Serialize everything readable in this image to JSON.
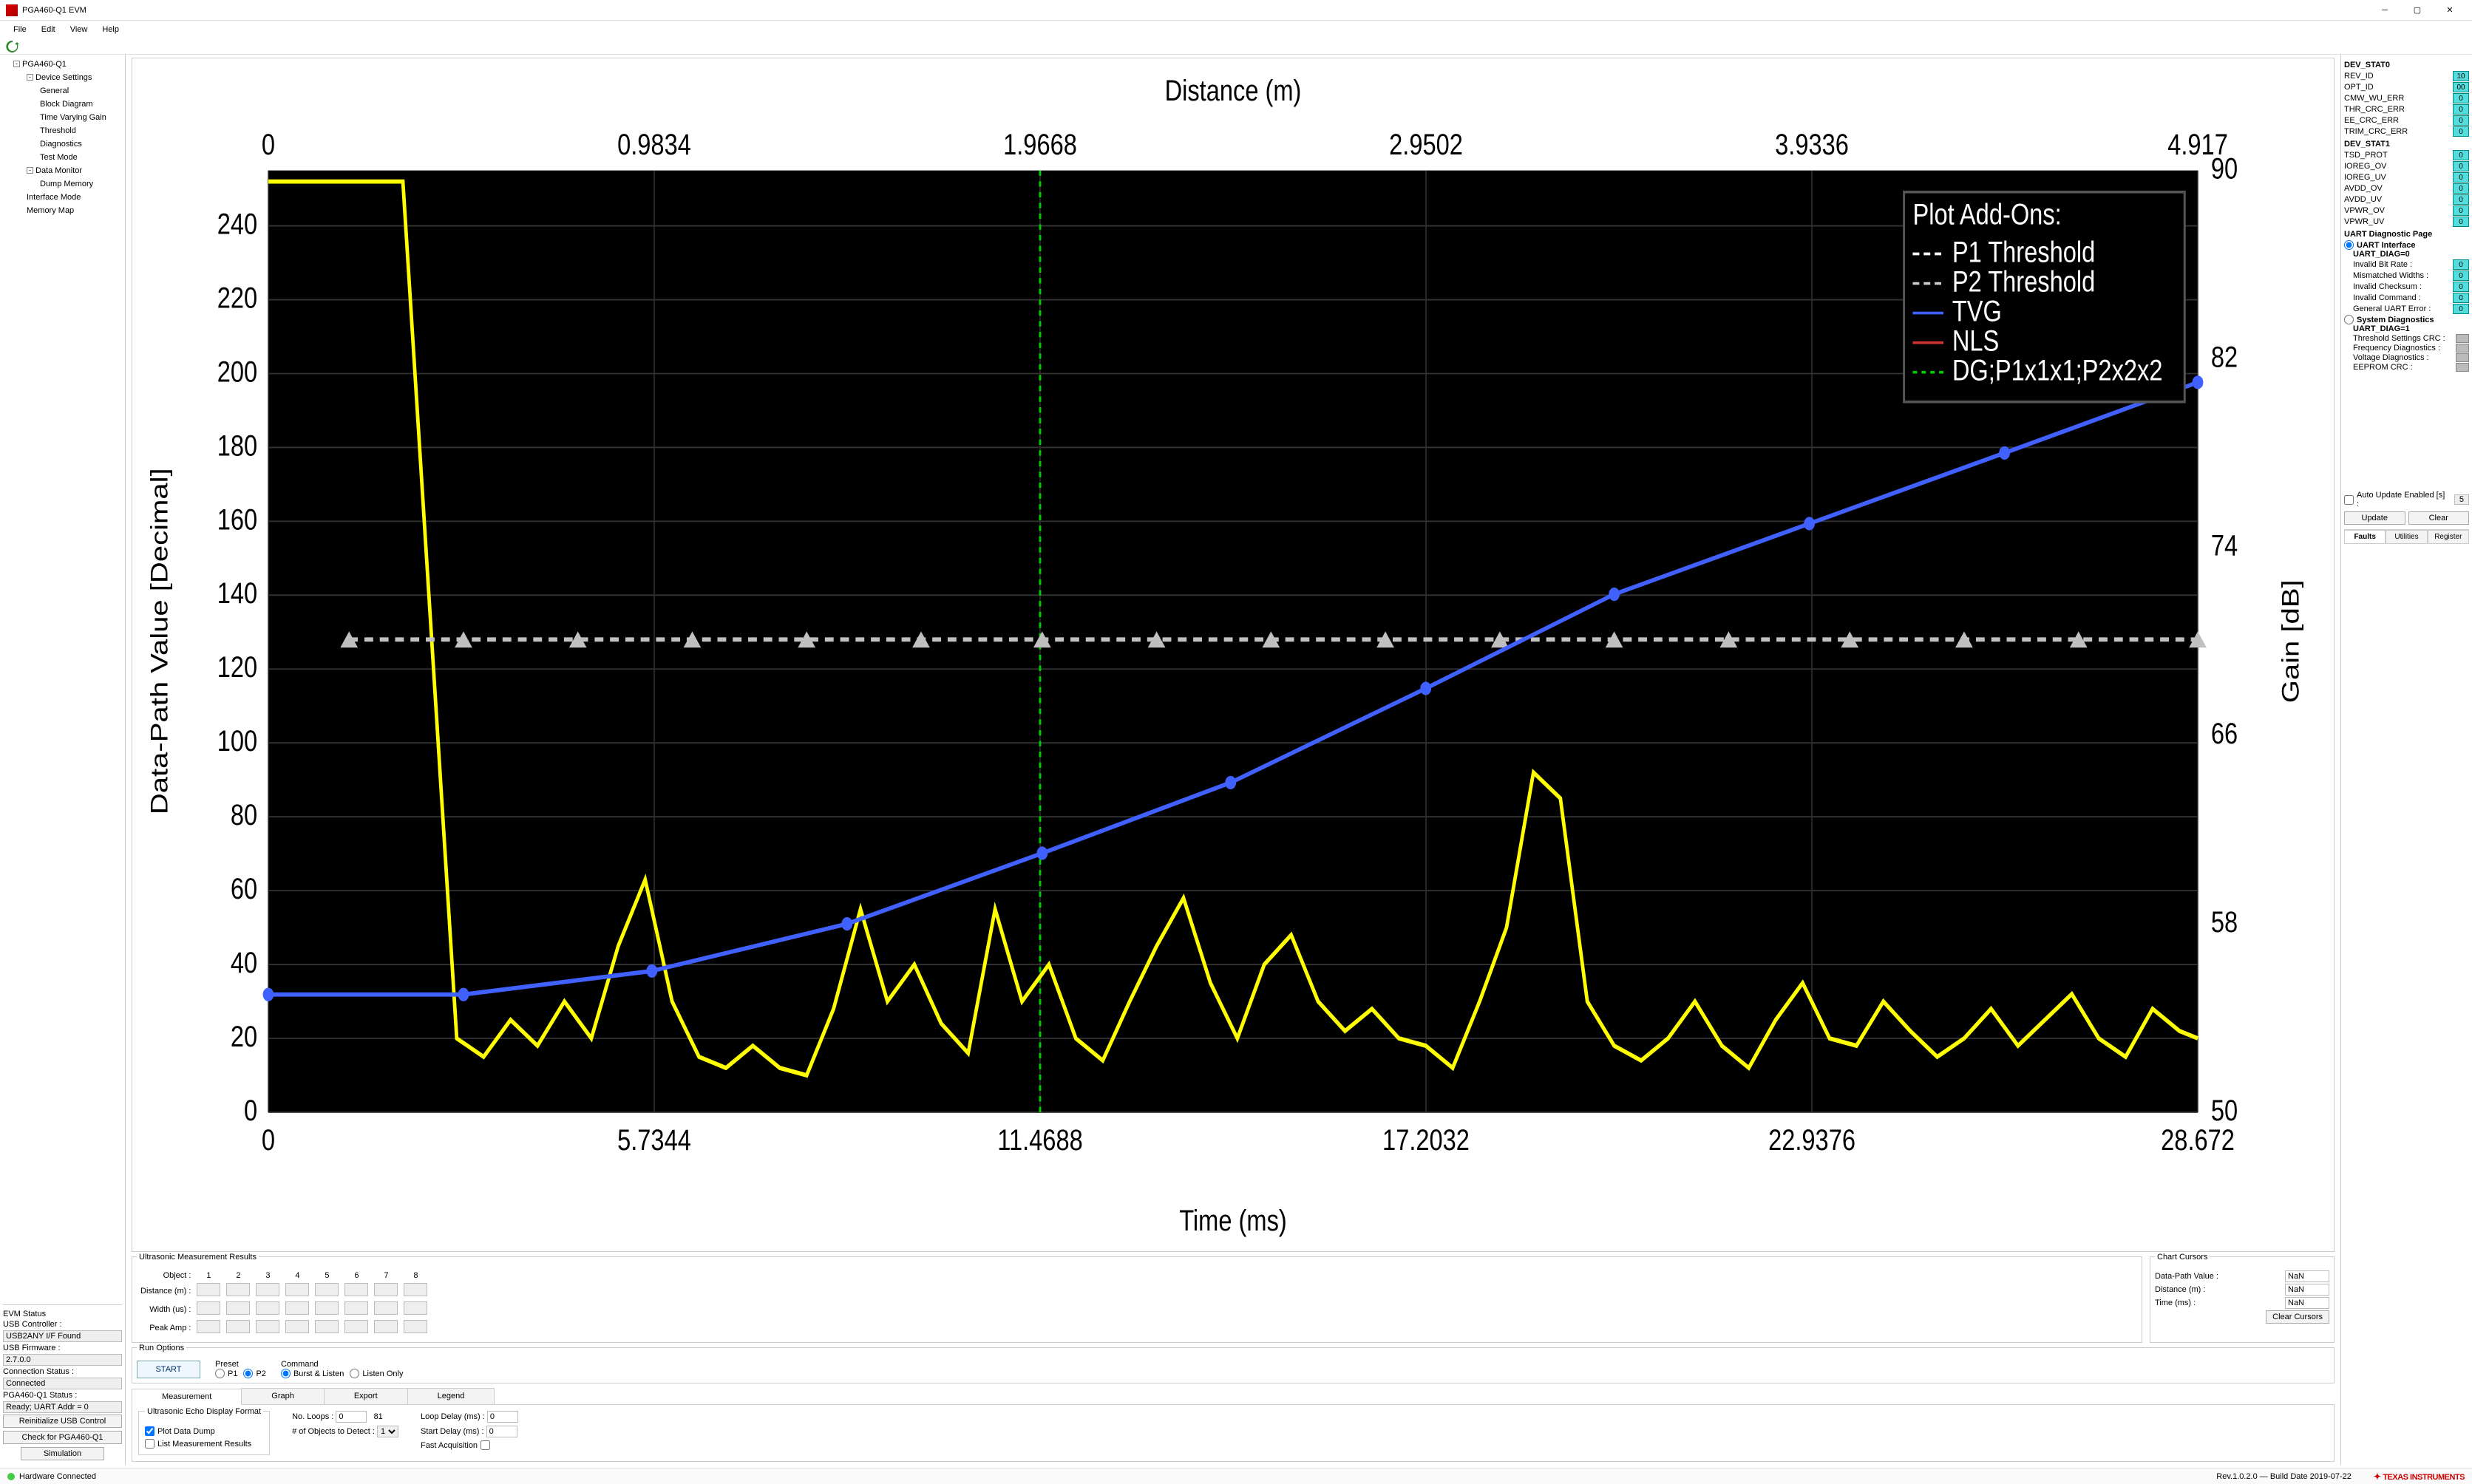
{
  "window": {
    "title": "PGA460-Q1 EVM"
  },
  "menu": [
    "File",
    "Edit",
    "View",
    "Help"
  ],
  "tree": {
    "root": "PGA460-Q1",
    "device_settings": "Device Settings",
    "general": "General",
    "block_diagram": "Block Diagram",
    "tvg": "Time Varying Gain",
    "threshold": "Threshold",
    "diagnostics": "Diagnostics",
    "test_mode": "Test Mode",
    "data_monitor": "Data Monitor",
    "dump_memory": "Dump Memory",
    "interface_mode": "Interface Mode",
    "memory_map": "Memory Map"
  },
  "evm_status": {
    "title": "EVM Status",
    "usb_ctrl_lbl": "USB Controller :",
    "usb_ctrl": "USB2ANY I/F Found",
    "usb_fw_lbl": "USB Firmware :",
    "usb_fw": "2.7.0.0",
    "conn_lbl": "Connection Status :",
    "conn": "Connected",
    "pga_lbl": "PGA460-Q1 Status :",
    "pga": "Ready; UART Addr = 0",
    "reinit": "Reinitialize USB Control",
    "check": "Check for PGA460-Q1",
    "sim": "Simulation"
  },
  "chart_data": {
    "type": "line",
    "x_label_top": "Distance (m)",
    "x_label_bottom": "Time (ms)",
    "y_label_left": "Data-Path Value [Decimal]",
    "y_label_right": "Gain [dB]",
    "x_ticks_top": [
      0,
      0.9834,
      1.9668,
      2.9502,
      3.9336,
      4.917
    ],
    "x_ticks_bottom": [
      0,
      5.7344,
      11.4688,
      17.2032,
      22.9376,
      28.672
    ],
    "y_ticks_left": [
      0,
      20,
      40,
      60,
      80,
      100,
      120,
      140,
      160,
      180,
      200,
      220,
      240
    ],
    "y_ticks_right": [
      50,
      58,
      66,
      74,
      82,
      90
    ],
    "legend_title": "Plot Add-Ons:",
    "legend": [
      "P1 Threshold",
      "P2 Threshold",
      "TVG",
      "NLS",
      "DG;P1x1x1;P2x2x2"
    ],
    "cursor_x_ms": 11.4688,
    "series": [
      {
        "name": "echo",
        "color": "#ffff00",
        "x_ms": [
          0,
          0.25,
          0.5,
          0.9,
          2,
          2.8,
          3.2,
          3.6,
          4,
          4.4,
          4.8,
          5.2,
          5.6,
          6,
          6.4,
          6.8,
          7.2,
          7.6,
          8,
          8.4,
          8.8,
          9.2,
          9.6,
          10,
          10.4,
          10.8,
          11.2,
          11.6,
          12,
          12.4,
          12.8,
          13.2,
          13.6,
          14,
          14.4,
          14.8,
          15.2,
          15.6,
          16,
          16.4,
          16.8,
          17.2,
          17.6,
          18,
          18.4,
          18.8,
          19.2,
          19.6,
          20,
          20.4,
          20.8,
          21.2,
          21.6,
          22,
          22.4,
          22.8,
          23.2,
          23.6,
          24,
          24.4,
          24.8,
          25.2,
          25.6,
          26,
          26.4,
          26.8,
          27.2,
          27.6,
          28,
          28.4,
          28.672
        ],
        "y": [
          252,
          252,
          252,
          252,
          252,
          20,
          15,
          25,
          18,
          30,
          20,
          45,
          63,
          30,
          15,
          12,
          18,
          12,
          10,
          28,
          55,
          30,
          40,
          24,
          16,
          55,
          30,
          40,
          20,
          14,
          30,
          45,
          58,
          35,
          20,
          40,
          48,
          30,
          22,
          28,
          20,
          18,
          12,
          30,
          50,
          92,
          85,
          30,
          18,
          14,
          20,
          30,
          18,
          12,
          25,
          35,
          20,
          18,
          30,
          22,
          15,
          20,
          28,
          18,
          25,
          32,
          20,
          15,
          28,
          22,
          20
        ]
      },
      {
        "name": "p2_threshold",
        "color": "#c0c0c0",
        "style": "dash-marker",
        "x_ms": [
          1.2,
          2.9,
          4.6,
          6.3,
          8,
          9.7,
          11.5,
          13.2,
          14.9,
          16.6,
          18.3,
          20,
          21.7,
          23.5,
          25.2,
          26.9,
          28.672
        ],
        "y": [
          128,
          128,
          128,
          128,
          128,
          128,
          128,
          128,
          128,
          128,
          128,
          128,
          128,
          128,
          128,
          128,
          128
        ]
      },
      {
        "name": "tvg",
        "color": "#4060ff",
        "x_ms": [
          0,
          2.9,
          5.7,
          8.6,
          11.5,
          14.3,
          17.2,
          20,
          22.9,
          25.8,
          28.672
        ],
        "y_right_db": [
          55,
          55,
          56,
          58,
          61,
          64,
          68,
          72,
          75,
          78,
          81
        ]
      }
    ]
  },
  "umr": {
    "title": "Ultrasonic Measurement Results",
    "object_lbl": "Object :",
    "cols": [
      "1",
      "2",
      "3",
      "4",
      "5",
      "6",
      "7",
      "8"
    ],
    "rows": [
      "Distance (m) :",
      "Width (us) :",
      "Peak Amp :"
    ]
  },
  "cursors": {
    "title": "Chart Cursors",
    "dpv_lbl": "Data-Path Value :",
    "dpv": "NaN",
    "dist_lbl": "Distance (m) :",
    "dist": "NaN",
    "time_lbl": "Time (ms) :",
    "time": "NaN",
    "clear": "Clear Cursors"
  },
  "run": {
    "title": "Run Options",
    "start": "START",
    "preset_lbl": "Preset",
    "p1": "P1",
    "p2": "P2",
    "cmd_lbl": "Command",
    "burst": "Burst & Listen",
    "listen": "Listen Only"
  },
  "tabs": [
    "Measurement",
    "Graph",
    "Export",
    "Legend"
  ],
  "meas": {
    "fmt_title": "Ultrasonic Echo Display Format",
    "plot_dump": "Plot Data Dump",
    "list_results": "List Measurement Results",
    "loops_lbl": "No. Loops :",
    "loops": "0",
    "loop_count": "81",
    "objects_lbl": "# of Objects to Detect :",
    "objects": "1",
    "loop_delay_lbl": "Loop Delay (ms) :",
    "loop_delay": "0",
    "start_delay_lbl": "Start Delay (ms) :",
    "start_delay": "0",
    "fast_acq": "Fast Acquisition"
  },
  "dev_stat0": {
    "title": "DEV_STAT0",
    "rows": [
      {
        "k": "REV_ID",
        "v": "10"
      },
      {
        "k": "OPT_ID",
        "v": "00"
      },
      {
        "k": "CMW_WU_ERR",
        "v": "0"
      },
      {
        "k": "THR_CRC_ERR",
        "v": "0"
      },
      {
        "k": "EE_CRC_ERR",
        "v": "0"
      },
      {
        "k": "TRIM_CRC_ERR",
        "v": "0"
      }
    ]
  },
  "dev_stat1": {
    "title": "DEV_STAT1",
    "rows": [
      {
        "k": "TSD_PROT",
        "v": "0"
      },
      {
        "k": "IOREG_OV",
        "v": "0"
      },
      {
        "k": "IOREG_UV",
        "v": "0"
      },
      {
        "k": "AVDD_OV",
        "v": "0"
      },
      {
        "k": "AVDD_UV",
        "v": "0"
      },
      {
        "k": "VPWR_OV",
        "v": "0"
      },
      {
        "k": "VPWR_UV",
        "v": "0"
      }
    ]
  },
  "uart_diag": {
    "title": "UART Diagnostic Page",
    "uart_if": "UART Interface",
    "d0": "UART_DIAG=0",
    "rows0": [
      {
        "k": "Invalid Bit Rate :",
        "v": "0"
      },
      {
        "k": "Mismatched Widths :",
        "v": "0"
      },
      {
        "k": "Invalid Checksum :",
        "v": "0"
      },
      {
        "k": "Invalid Command :",
        "v": "0"
      },
      {
        "k": "General UART Error :",
        "v": "0"
      }
    ],
    "sys_diag": "System Diagnostics",
    "d1": "UART_DIAG=1",
    "rows1": [
      "Threshold Settings CRC :",
      "Frequency Diagnostics :",
      "Voltage Diagnostics :",
      "EEPROM CRC :"
    ]
  },
  "autoupdate": {
    "lbl": "Auto Update Enabled [s] :",
    "val": "5",
    "update": "Update",
    "clear": "Clear"
  },
  "btabs": [
    "Faults",
    "Utilities",
    "Register"
  ],
  "status": {
    "hw": "Hardware Connected",
    "build": "Rev.1.0.2.0 — Build Date 2019-07-22",
    "ti": "TEXAS INSTRUMENTS"
  }
}
